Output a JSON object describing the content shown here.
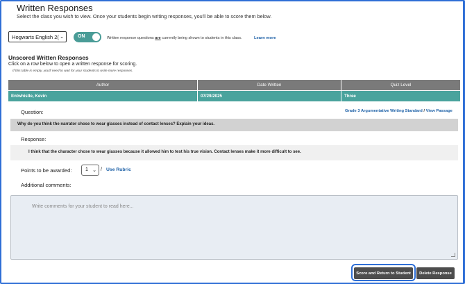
{
  "header": {
    "title": "Written Responses",
    "subtitle": "Select the class you wish to view. Once your students begin writing responses, you'll be able to score them below."
  },
  "class_selector": {
    "selected": "Hogwarts English 2("
  },
  "visibility": {
    "toggle_label": "ON",
    "note_before": "Written response questions ",
    "note_emphasis": "are",
    "note_after": " currently being shown to students in this class.",
    "learn_more": "Learn more"
  },
  "unscored": {
    "heading": "Unscored Written Responses",
    "instructions": "Click on a row below to open a written response for scoring.",
    "note": "If this table is empty, you'll need to wait for your students to write more responses.",
    "columns": [
      "Author",
      "Date Written",
      "Quiz Level"
    ],
    "rows": [
      {
        "author": "Entwhistle, Kevin",
        "date": "07/29/2025",
        "level": "Three"
      }
    ]
  },
  "question": {
    "label": "Question:",
    "standard_link": "Grade 3 Argumentative Writing Standard",
    "separator": " / ",
    "passage_link": "View Passage",
    "text": "Why do you think the narrator chose to wear glasses instead of contact lenses? Explain your ideas."
  },
  "response": {
    "label": "Response:",
    "text": "I think that the character chose to wear glasses because it allowed him to test his true vision. Contact lenses make it more difficult to see."
  },
  "points": {
    "label": "Points to be awarded:",
    "selected": "1",
    "slash": "/",
    "rubric_link": "Use Rubric"
  },
  "comments": {
    "label": "Additional comments:",
    "placeholder": "Write comments for your student to read here..."
  },
  "actions": {
    "score_label": "Score and Return to Student",
    "delete_label": "Delete Response"
  },
  "colors": {
    "accent_teal": "#4aa39d",
    "link_blue": "#1b5fa6",
    "focus_blue": "#2f6fd6",
    "button_dark": "#4d4d4d",
    "header_gray": "#7a7a7a"
  }
}
